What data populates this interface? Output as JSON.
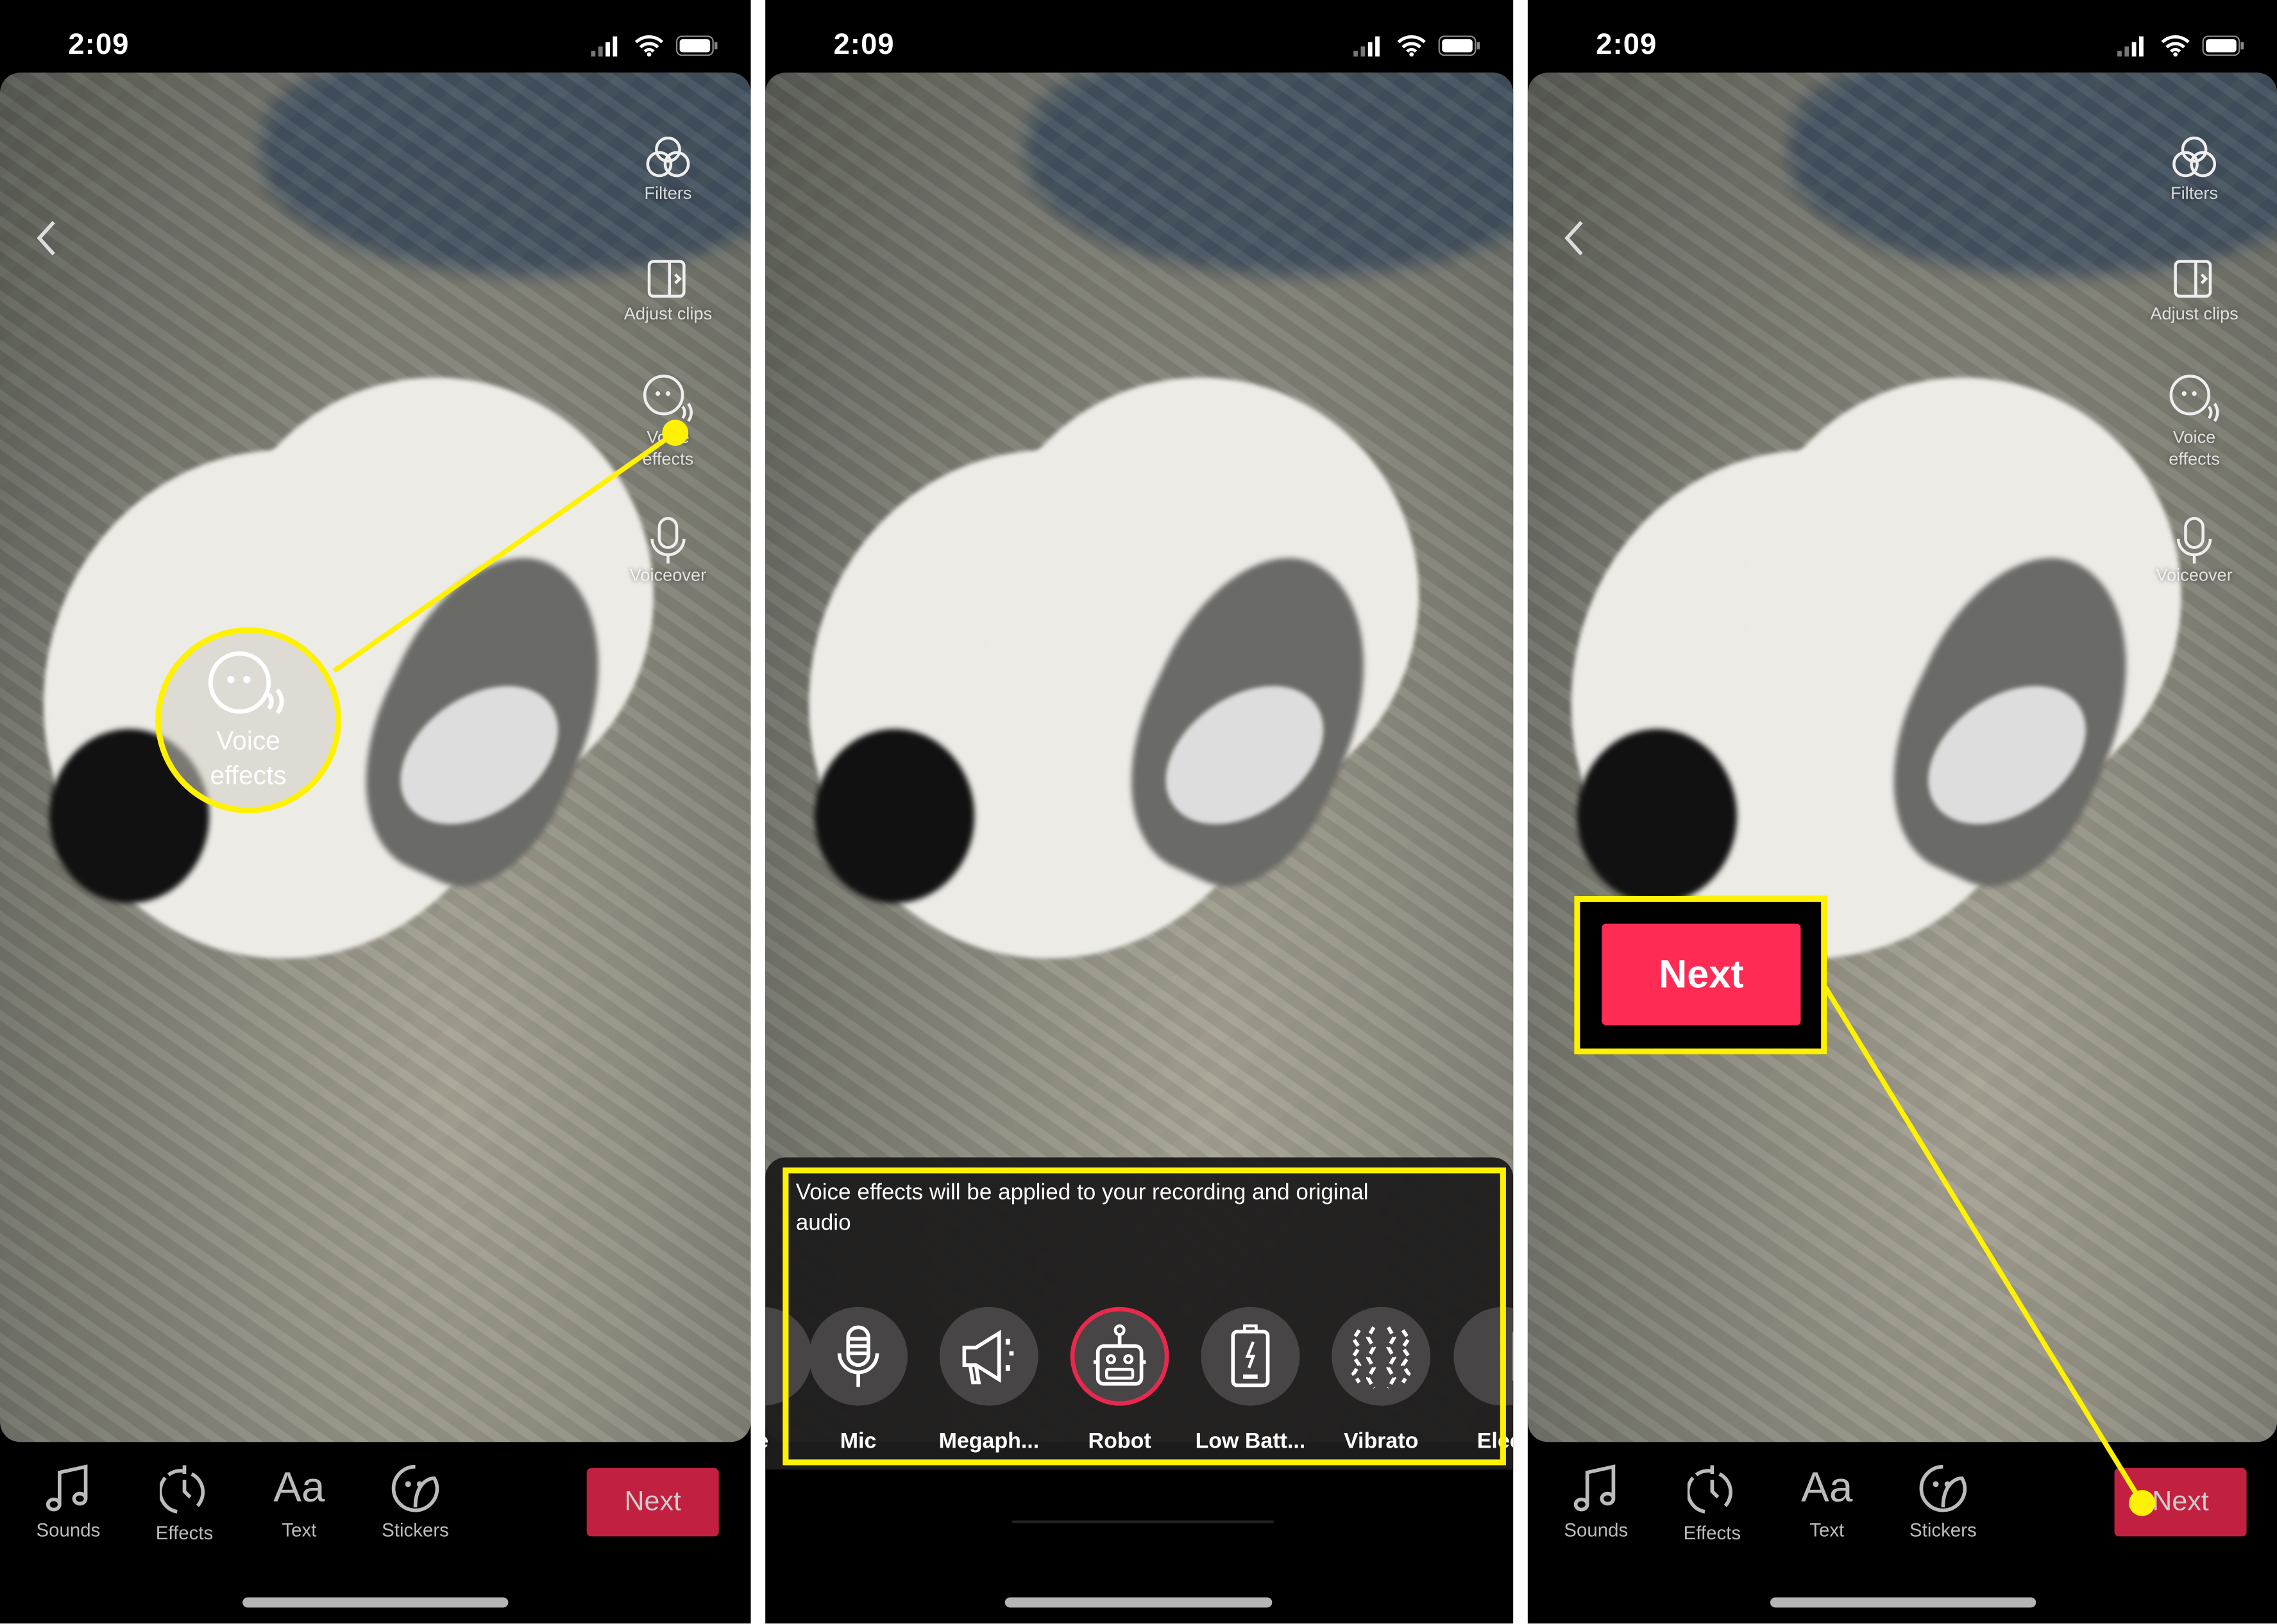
{
  "status_bar": {
    "time": "2:09"
  },
  "rail": {
    "filters": "Filters",
    "adjust_clips": "Adjust clips",
    "voice_effects_line1": "Voice",
    "voice_effects_line2": "effects",
    "voiceover": "Voiceover"
  },
  "toolbar": {
    "sounds": "Sounds",
    "effects": "Effects",
    "text": "Text",
    "stickers": "Stickers",
    "next": "Next"
  },
  "callout": {
    "voice_line1": "Voice",
    "voice_line2": "effects",
    "next": "Next"
  },
  "voice_sheet": {
    "message": "Voice effects will be applied to your recording and original audio",
    "effects": [
      {
        "label": "e",
        "icon": "partial-icon",
        "selected": false
      },
      {
        "label": "Mic",
        "icon": "microphone-icon",
        "selected": false
      },
      {
        "label": "Megaph...",
        "icon": "megaphone-icon",
        "selected": false
      },
      {
        "label": "Robot",
        "icon": "robot-icon",
        "selected": true
      },
      {
        "label": "Low Batt...",
        "icon": "battery-icon",
        "selected": false
      },
      {
        "label": "Vibrato",
        "icon": "vibrato-icon",
        "selected": false
      },
      {
        "label": "Elect",
        "icon": "electronic-icon",
        "selected": false
      }
    ]
  },
  "colors": {
    "highlight": "#fff200",
    "accent": "#fe2c55",
    "next_dim": "#c12040",
    "selected_ring": "#e8294d"
  }
}
